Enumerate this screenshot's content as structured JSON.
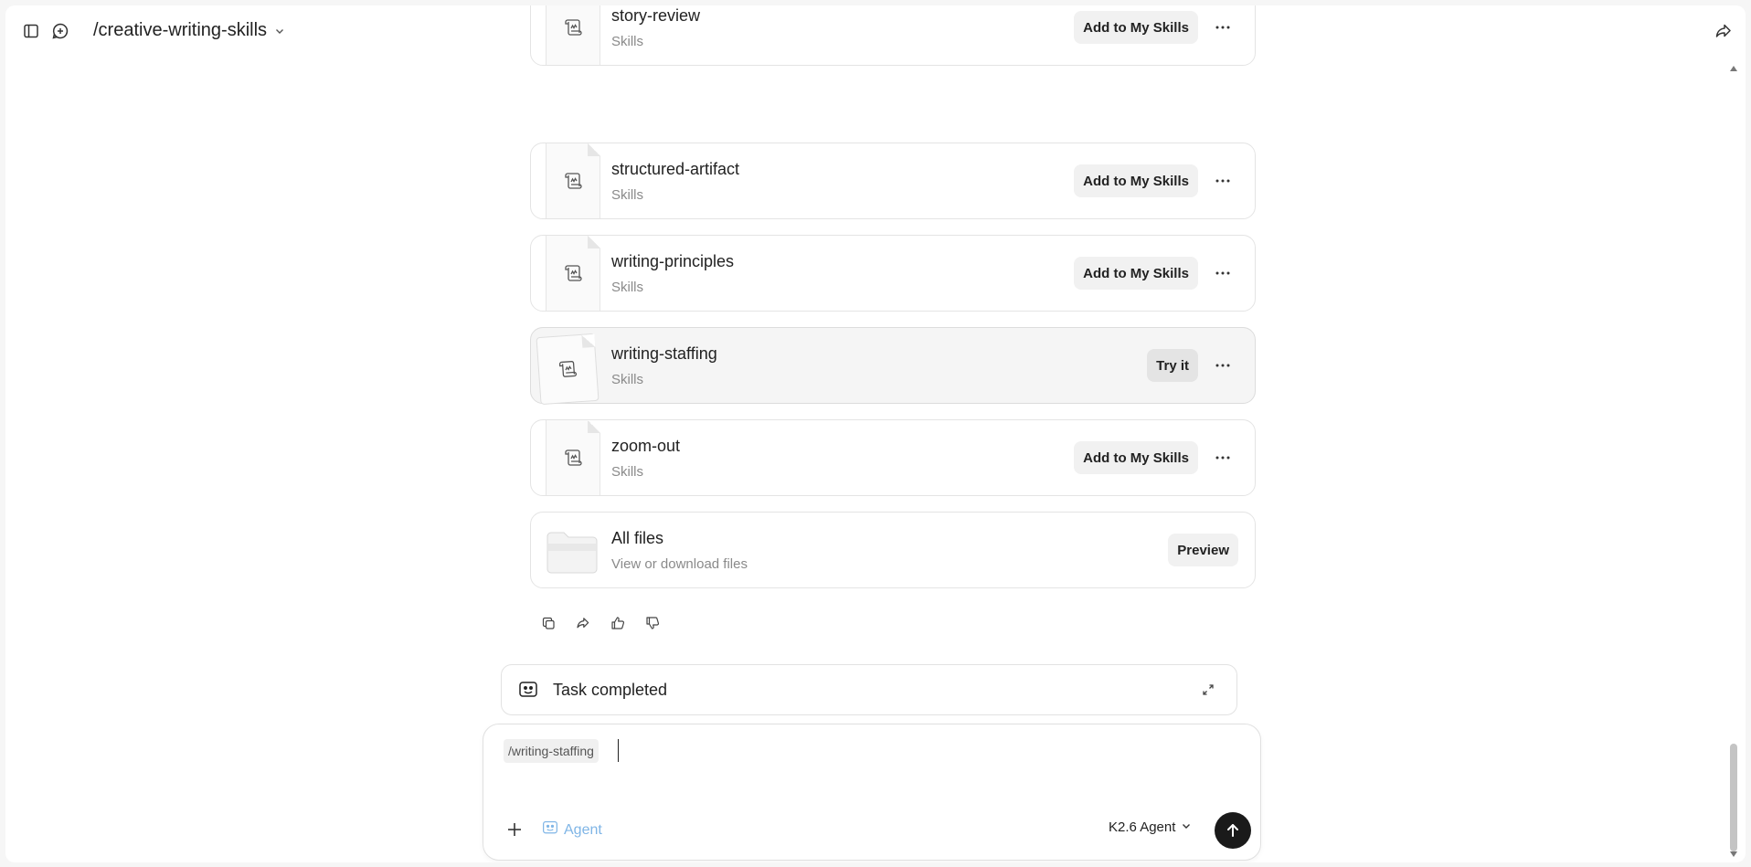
{
  "header": {
    "title": "/creative-writing-skills",
    "sidebar_toggle_icon": "sidebar-toggle-icon",
    "new_chat_icon": "new-chat-icon",
    "share_icon": "share-icon"
  },
  "skills": [
    {
      "name": "story-review",
      "type": "Skills",
      "action": "Add to My Skills"
    },
    {
      "name": "structured-artifact",
      "type": "Skills",
      "action": "Add to My Skills"
    },
    {
      "name": "writing-principles",
      "type": "Skills",
      "action": "Add to My Skills"
    },
    {
      "name": "writing-staffing",
      "type": "Skills",
      "action": "Try it"
    },
    {
      "name": "zoom-out",
      "type": "Skills",
      "action": "Add to My Skills"
    }
  ],
  "all_files": {
    "name": "All files",
    "description": "View or download files",
    "action": "Preview"
  },
  "message_actions": [
    "copy-icon",
    "share-icon",
    "thumbs-up-icon",
    "thumbs-down-icon"
  ],
  "task": {
    "label": "Task completed"
  },
  "composer": {
    "chip": "/writing-staffing",
    "mode": "Agent",
    "model": "K2.6 Agent"
  },
  "colors": {
    "accent_agent": "#7fb5e6",
    "send_button": "#1a1a1a"
  }
}
